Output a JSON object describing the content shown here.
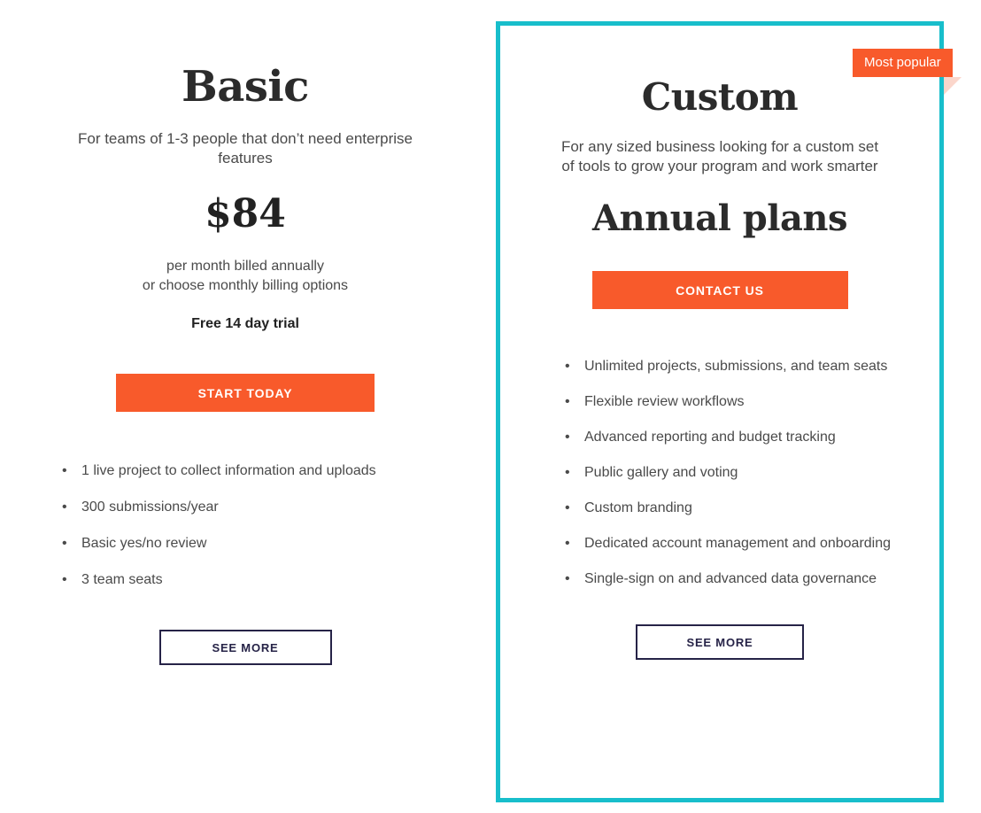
{
  "theme": {
    "accent_orange": "#F85A2B",
    "accent_teal": "#18BECB",
    "outline_navy": "#262347",
    "ribbon_fold": "#FBD6CB",
    "background": "#FFFFFF",
    "body_text": "#4A4A4A",
    "heading_text": "#2B2B2B"
  },
  "plans": [
    {
      "id": "basic",
      "title": "Basic",
      "description": "For teams of 1-3 people that don’t need enterprise features",
      "price": "$84",
      "price_note_line1": "per month billed annually",
      "price_note_line2": "or choose monthly billing options",
      "trial_note": "Free 14 day trial",
      "primary_cta": "START TODAY",
      "secondary_cta": "SEE MORE",
      "bullet_glyph": "•",
      "features": [
        "1 live project to collect information and uploads",
        "300 submissions/year",
        "Basic yes/no review",
        "3 team seats"
      ]
    },
    {
      "id": "custom",
      "title": "Custom",
      "description": "For any sized business looking for a custom set of tools to grow your program and work smarter",
      "annual_heading": "Annual plans",
      "badge": "Most popular",
      "primary_cta": "CONTACT US",
      "secondary_cta": "SEE MORE",
      "bullet_glyph": "•",
      "features": [
        "Unlimited projects, submissions, and team seats",
        "Flexible review workflows",
        "Advanced reporting and budget tracking",
        "Public gallery and voting",
        "Custom branding",
        "Dedicated account management and onboarding",
        "Single-sign on and advanced data governance"
      ]
    }
  ]
}
